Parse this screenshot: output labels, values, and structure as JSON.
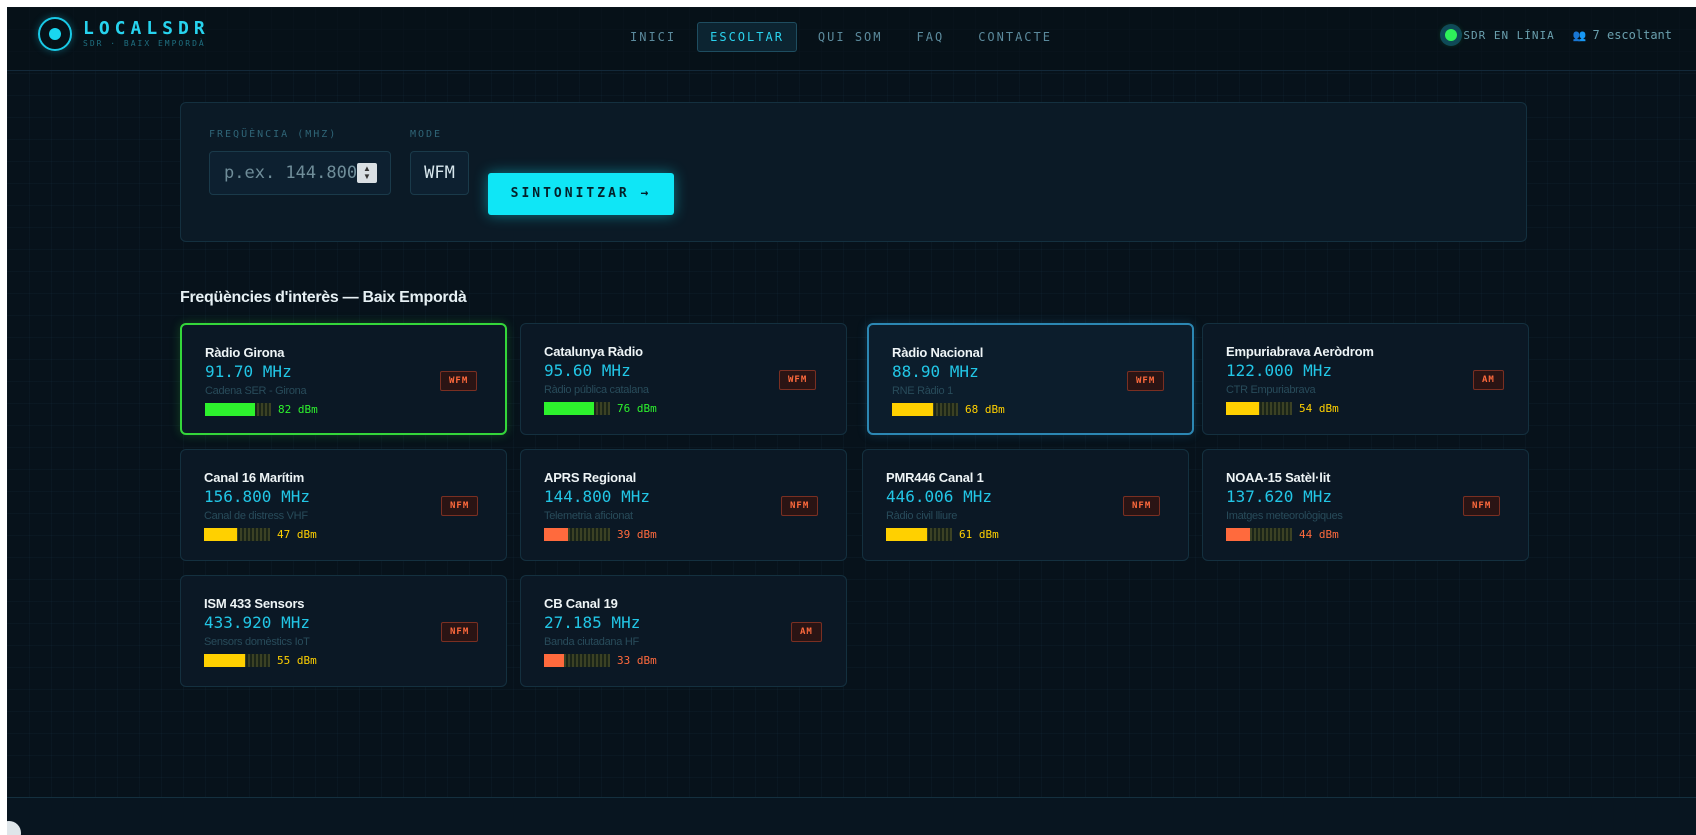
{
  "brand": {
    "title": "LOCALSDR",
    "subtitle": "SDR · BAIX EMPORDÀ"
  },
  "nav": [
    "INICI",
    "ESCOLTAR",
    "QUI SOM",
    "FAQ",
    "CONTACTE"
  ],
  "nav_active": "ESCOLTAR",
  "status": {
    "online_label": "SDR EN LÍNIA",
    "listeners_label": "7 escoltant",
    "online_color": "#2ef05a"
  },
  "tuner": {
    "freq_label": "FREQÜÈNCIA (MHZ)",
    "freq_placeholder": "p.ex. 144.800",
    "mode_label": "MODE",
    "mode_value": "WFM",
    "tune_button": "SINTONITZAR →"
  },
  "section_title": "Freqüències d'interès — Baix Empordà",
  "colors": {
    "accent": "#0fe6f6",
    "strong": "#2df22d",
    "medium": "#ffd000",
    "weak": "#ff6a3d"
  },
  "stations": [
    {
      "name": "Ràdio Girona",
      "freq": "91.70 MHz",
      "desc": "Cadena SER - Girona",
      "mode": "WFM",
      "dbm": "82 dBm",
      "level": 0.75,
      "strength": "strong",
      "selected": "green"
    },
    {
      "name": "Catalunya Ràdio",
      "freq": "95.60 MHz",
      "desc": "Ràdio pública catalana",
      "mode": "WFM",
      "dbm": "76 dBm",
      "level": 0.75,
      "strength": "strong",
      "selected": ""
    },
    {
      "name": "Ràdio Nacional",
      "freq": "88.90 MHz",
      "desc": "RNE Ràdio 1",
      "mode": "WFM",
      "dbm": "68 dBm",
      "level": 0.62,
      "strength": "medium",
      "selected": "blue"
    },
    {
      "name": "Empuriabrava Aeròdrom",
      "freq": "122.000 MHz",
      "desc": "CTR Empuriabrava",
      "mode": "AM",
      "dbm": "54 dBm",
      "level": 0.5,
      "strength": "medium",
      "selected": ""
    },
    {
      "name": "Canal 16 Marítim",
      "freq": "156.800 MHz",
      "desc": "Canal de distress VHF",
      "mode": "NFM",
      "dbm": "47 dBm",
      "level": 0.5,
      "strength": "medium",
      "selected": ""
    },
    {
      "name": "APRS Regional",
      "freq": "144.800 MHz",
      "desc": "Telemetria aficionat",
      "mode": "NFM",
      "dbm": "39 dBm",
      "level": 0.37,
      "strength": "weak",
      "selected": ""
    },
    {
      "name": "PMR446 Canal 1",
      "freq": "446.006 MHz",
      "desc": "Ràdio civil lliure",
      "mode": "NFM",
      "dbm": "61 dBm",
      "level": 0.62,
      "strength": "medium",
      "selected": ""
    },
    {
      "name": "NOAA-15 Satèl·lit",
      "freq": "137.620 MHz",
      "desc": "Imatges meteorològiques",
      "mode": "NFM",
      "dbm": "44 dBm",
      "level": 0.37,
      "strength": "weak",
      "selected": ""
    },
    {
      "name": "ISM 433 Sensors",
      "freq": "433.920 MHz",
      "desc": "Sensors domèstics IoT",
      "mode": "NFM",
      "dbm": "55 dBm",
      "level": 0.62,
      "strength": "medium",
      "selected": ""
    },
    {
      "name": "CB Canal 19",
      "freq": "27.185 MHz",
      "desc": "Banda ciutadana HF",
      "mode": "AM",
      "dbm": "33 dBm",
      "level": 0.3,
      "strength": "weak",
      "selected": ""
    }
  ]
}
